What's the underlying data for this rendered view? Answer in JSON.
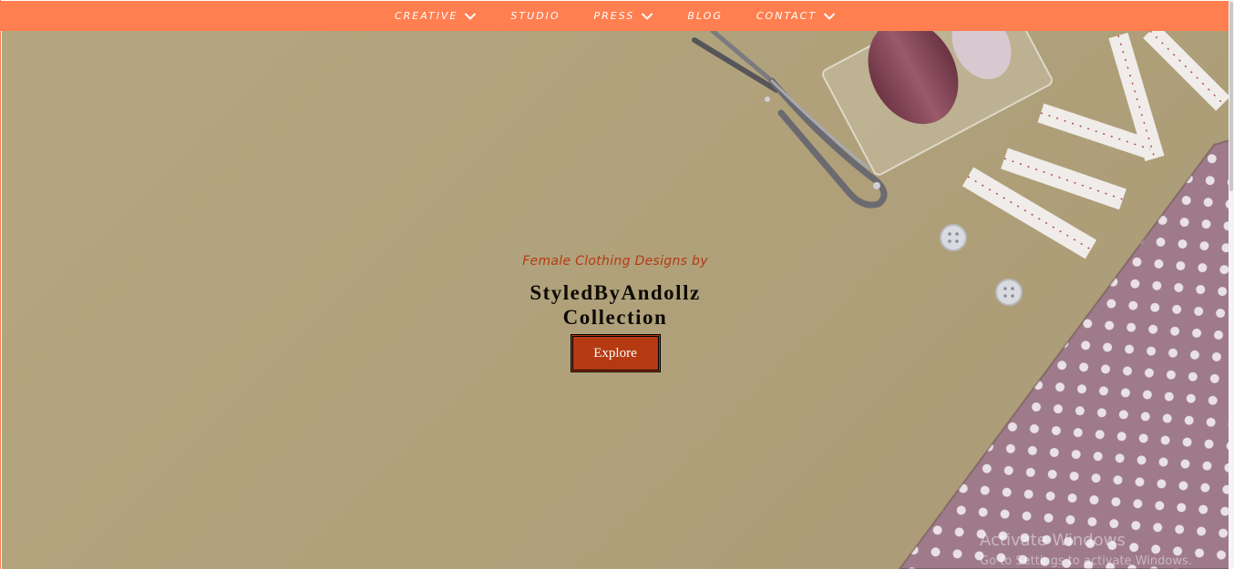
{
  "nav": {
    "items": [
      {
        "label": "CREATIVE",
        "has_dropdown": true
      },
      {
        "label": "STUDIO",
        "has_dropdown": false
      },
      {
        "label": "PRESS",
        "has_dropdown": true
      },
      {
        "label": "BLOG",
        "has_dropdown": false
      },
      {
        "label": "CONTACT",
        "has_dropdown": true
      }
    ]
  },
  "hero": {
    "subtitle": "Female Clothing Designs by",
    "title": "StyledByAndollz Collection",
    "button_label": "Explore"
  },
  "watermark": {
    "title": "Activate Windows",
    "subtitle": "Go to Settings to activate Windows."
  },
  "colors": {
    "nav_background": "#ff7f50",
    "hero_background": "#b2a37c",
    "accent": "#b53a12",
    "fabric": "#9e7a8a"
  },
  "icons": {
    "dropdown": "chevron-down-icon",
    "decor": [
      "thread-snips-icon",
      "thread-spool-icon",
      "measuring-tape-icon",
      "button-icon",
      "polka-dot-fabric-icon"
    ]
  }
}
